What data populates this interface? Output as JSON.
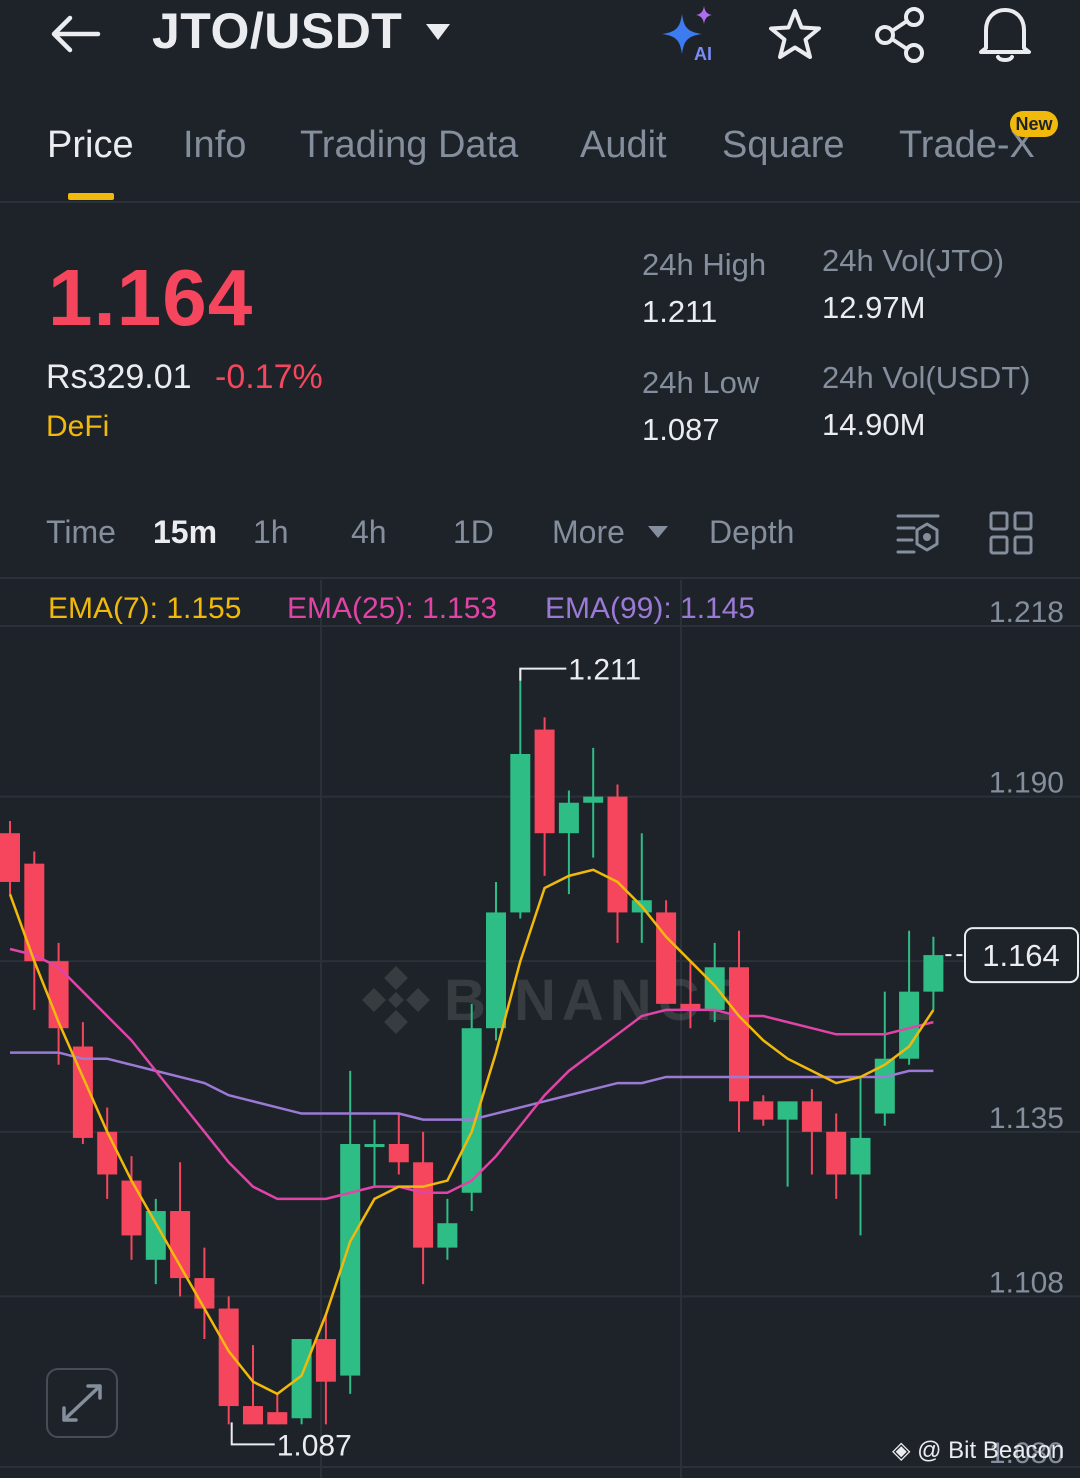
{
  "header": {
    "title": "JTO/USDT",
    "ai_label": "AI"
  },
  "tabs": [
    {
      "label": "Price",
      "active": true
    },
    {
      "label": "Info"
    },
    {
      "label": "Trading Data"
    },
    {
      "label": "Audit"
    },
    {
      "label": "Square"
    },
    {
      "label": "Trade-X",
      "badge": "New"
    }
  ],
  "price": {
    "last": "1.164",
    "fiat": "Rs329.01",
    "change": "-0.17%",
    "tag": "DeFi"
  },
  "stats": {
    "high_label": "24h High",
    "high": "1.211",
    "low_label": "24h Low",
    "low": "1.087",
    "vol_base_label": "24h Vol(JTO)",
    "vol_base": "12.97M",
    "vol_quote_label": "24h Vol(USDT)",
    "vol_quote": "14.90M"
  },
  "intervals": {
    "time": "Time",
    "items": [
      "15m",
      "1h",
      "4h",
      "1D"
    ],
    "active": "15m",
    "more": "More",
    "depth": "Depth"
  },
  "indicators": {
    "ema7": "EMA(7): 1.155",
    "ema25": "EMA(25): 1.153",
    "ema99": "EMA(99): 1.145"
  },
  "colors": {
    "up": "#2ebd85",
    "down": "#f6465d",
    "accent": "#f0b90b",
    "ema7": "#f0b90b",
    "ema25": "#e044a7",
    "ema99": "#9b7ad6"
  },
  "chart_data": {
    "type": "candlestick",
    "y_ticks": [
      "1.218",
      "1.190",
      "1.163",
      "1.135",
      "1.108",
      "1.080"
    ],
    "ylim": [
      1.08,
      1.218
    ],
    "current_price": "1.164",
    "high_marker": "1.211",
    "low_marker": "1.087",
    "watermark_text": "BINANCE",
    "candles": [
      {
        "o": 1.184,
        "h": 1.186,
        "l": 1.174,
        "c": 1.176
      },
      {
        "o": 1.179,
        "h": 1.181,
        "l": 1.155,
        "c": 1.163
      },
      {
        "o": 1.163,
        "h": 1.166,
        "l": 1.146,
        "c": 1.152
      },
      {
        "o": 1.149,
        "h": 1.153,
        "l": 1.133,
        "c": 1.134
      },
      {
        "o": 1.135,
        "h": 1.139,
        "l": 1.124,
        "c": 1.128
      },
      {
        "o": 1.127,
        "h": 1.131,
        "l": 1.114,
        "c": 1.118
      },
      {
        "o": 1.114,
        "h": 1.124,
        "l": 1.11,
        "c": 1.122
      },
      {
        "o": 1.122,
        "h": 1.13,
        "l": 1.108,
        "c": 1.111
      },
      {
        "o": 1.111,
        "h": 1.116,
        "l": 1.101,
        "c": 1.106
      },
      {
        "o": 1.106,
        "h": 1.108,
        "l": 1.087,
        "c": 1.09
      },
      {
        "o": 1.09,
        "h": 1.1,
        "l": 1.088,
        "c": 1.087
      },
      {
        "o": 1.089,
        "h": 1.092,
        "l": 1.087,
        "c": 1.087
      },
      {
        "o": 1.088,
        "h": 1.097,
        "l": 1.087,
        "c": 1.101
      },
      {
        "o": 1.101,
        "h": 1.105,
        "l": 1.087,
        "c": 1.094
      },
      {
        "o": 1.095,
        "h": 1.145,
        "l": 1.092,
        "c": 1.133
      },
      {
        "o": 1.133,
        "h": 1.137,
        "l": 1.126,
        "c": 1.133
      },
      {
        "o": 1.133,
        "h": 1.138,
        "l": 1.128,
        "c": 1.13
      },
      {
        "o": 1.13,
        "h": 1.135,
        "l": 1.11,
        "c": 1.116
      },
      {
        "o": 1.116,
        "h": 1.124,
        "l": 1.114,
        "c": 1.12
      },
      {
        "o": 1.125,
        "h": 1.156,
        "l": 1.122,
        "c": 1.152
      },
      {
        "o": 1.152,
        "h": 1.176,
        "l": 1.15,
        "c": 1.171
      },
      {
        "o": 1.171,
        "h": 1.211,
        "l": 1.17,
        "c": 1.197
      },
      {
        "o": 1.201,
        "h": 1.203,
        "l": 1.177,
        "c": 1.184
      },
      {
        "o": 1.184,
        "h": 1.191,
        "l": 1.174,
        "c": 1.189
      },
      {
        "o": 1.189,
        "h": 1.198,
        "l": 1.18,
        "c": 1.19
      },
      {
        "o": 1.19,
        "h": 1.192,
        "l": 1.166,
        "c": 1.171
      },
      {
        "o": 1.171,
        "h": 1.184,
        "l": 1.166,
        "c": 1.173
      },
      {
        "o": 1.171,
        "h": 1.173,
        "l": 1.158,
        "c": 1.156
      },
      {
        "o": 1.156,
        "h": 1.163,
        "l": 1.152,
        "c": 1.155
      },
      {
        "o": 1.155,
        "h": 1.166,
        "l": 1.153,
        "c": 1.162
      },
      {
        "o": 1.162,
        "h": 1.168,
        "l": 1.135,
        "c": 1.14
      },
      {
        "o": 1.14,
        "h": 1.141,
        "l": 1.136,
        "c": 1.137
      },
      {
        "o": 1.137,
        "h": 1.138,
        "l": 1.126,
        "c": 1.14
      },
      {
        "o": 1.14,
        "h": 1.142,
        "l": 1.128,
        "c": 1.135
      },
      {
        "o": 1.135,
        "h": 1.138,
        "l": 1.124,
        "c": 1.128
      },
      {
        "o": 1.128,
        "h": 1.144,
        "l": 1.118,
        "c": 1.134
      },
      {
        "o": 1.138,
        "h": 1.158,
        "l": 1.136,
        "c": 1.147
      },
      {
        "o": 1.147,
        "h": 1.168,
        "l": 1.146,
        "c": 1.158
      },
      {
        "o": 1.158,
        "h": 1.167,
        "l": 1.155,
        "c": 1.164
      }
    ],
    "ema7": [
      1.174,
      1.163,
      1.153,
      1.144,
      1.135,
      1.127,
      1.12,
      1.113,
      1.106,
      1.099,
      1.094,
      1.092,
      1.095,
      1.105,
      1.117,
      1.124,
      1.126,
      1.126,
      1.127,
      1.135,
      1.148,
      1.163,
      1.175,
      1.177,
      1.178,
      1.176,
      1.172,
      1.167,
      1.163,
      1.159,
      1.154,
      1.15,
      1.147,
      1.145,
      1.143,
      1.144,
      1.146,
      1.149,
      1.155
    ],
    "ema25": [
      1.165,
      1.164,
      1.162,
      1.158,
      1.154,
      1.15,
      1.145,
      1.14,
      1.135,
      1.13,
      1.126,
      1.124,
      1.124,
      1.124,
      1.125,
      1.126,
      1.126,
      1.125,
      1.125,
      1.127,
      1.131,
      1.136,
      1.141,
      1.145,
      1.148,
      1.151,
      1.154,
      1.155,
      1.155,
      1.155,
      1.154,
      1.154,
      1.153,
      1.152,
      1.151,
      1.151,
      1.151,
      1.152,
      1.153
    ],
    "ema99": [
      1.148,
      1.148,
      1.148,
      1.147,
      1.147,
      1.146,
      1.145,
      1.144,
      1.143,
      1.141,
      1.14,
      1.139,
      1.138,
      1.138,
      1.138,
      1.138,
      1.138,
      1.137,
      1.137,
      1.137,
      1.138,
      1.139,
      1.14,
      1.141,
      1.142,
      1.143,
      1.143,
      1.144,
      1.144,
      1.144,
      1.144,
      1.144,
      1.144,
      1.144,
      1.144,
      1.144,
      1.144,
      1.145,
      1.145
    ]
  },
  "watermark": {
    "text": "@ Bit Beacon"
  }
}
